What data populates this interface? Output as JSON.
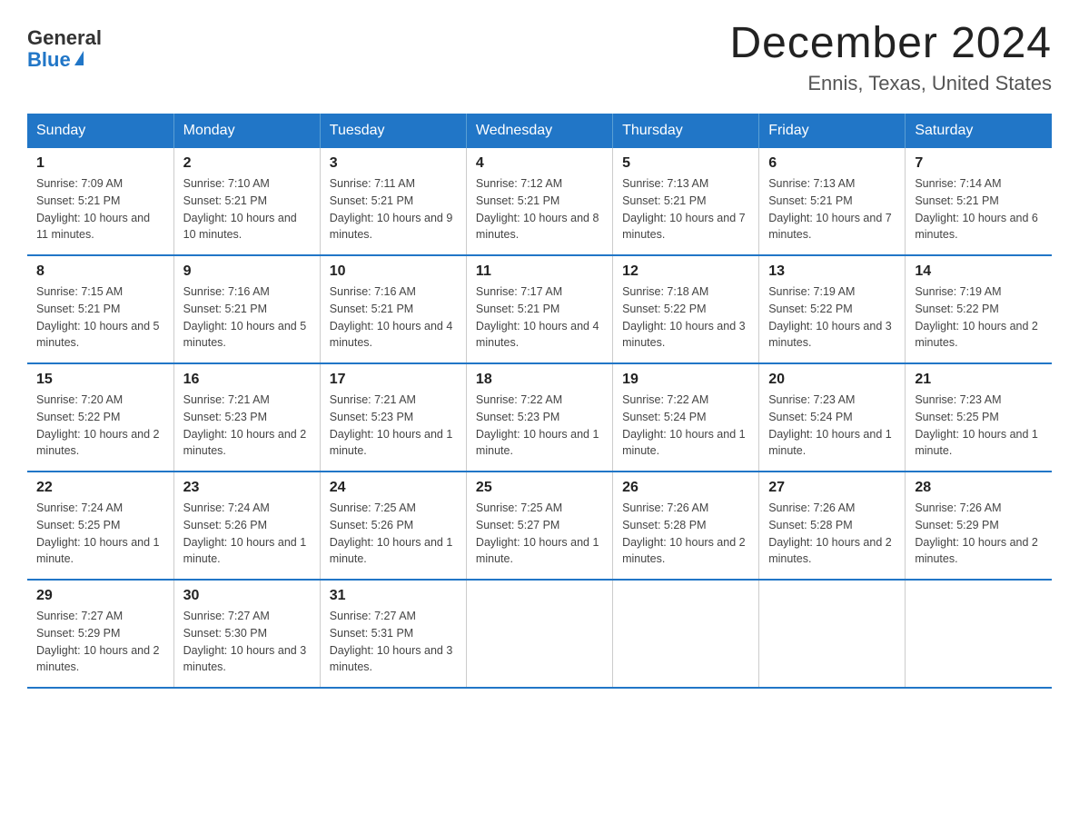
{
  "header": {
    "logo_general": "General",
    "logo_blue": "Blue",
    "title": "December 2024",
    "subtitle": "Ennis, Texas, United States"
  },
  "days_of_week": [
    "Sunday",
    "Monday",
    "Tuesday",
    "Wednesday",
    "Thursday",
    "Friday",
    "Saturday"
  ],
  "weeks": [
    [
      {
        "day": "1",
        "sunrise": "7:09 AM",
        "sunset": "5:21 PM",
        "daylight": "10 hours and 11 minutes."
      },
      {
        "day": "2",
        "sunrise": "7:10 AM",
        "sunset": "5:21 PM",
        "daylight": "10 hours and 10 minutes."
      },
      {
        "day": "3",
        "sunrise": "7:11 AM",
        "sunset": "5:21 PM",
        "daylight": "10 hours and 9 minutes."
      },
      {
        "day": "4",
        "sunrise": "7:12 AM",
        "sunset": "5:21 PM",
        "daylight": "10 hours and 8 minutes."
      },
      {
        "day": "5",
        "sunrise": "7:13 AM",
        "sunset": "5:21 PM",
        "daylight": "10 hours and 7 minutes."
      },
      {
        "day": "6",
        "sunrise": "7:13 AM",
        "sunset": "5:21 PM",
        "daylight": "10 hours and 7 minutes."
      },
      {
        "day": "7",
        "sunrise": "7:14 AM",
        "sunset": "5:21 PM",
        "daylight": "10 hours and 6 minutes."
      }
    ],
    [
      {
        "day": "8",
        "sunrise": "7:15 AM",
        "sunset": "5:21 PM",
        "daylight": "10 hours and 5 minutes."
      },
      {
        "day": "9",
        "sunrise": "7:16 AM",
        "sunset": "5:21 PM",
        "daylight": "10 hours and 5 minutes."
      },
      {
        "day": "10",
        "sunrise": "7:16 AM",
        "sunset": "5:21 PM",
        "daylight": "10 hours and 4 minutes."
      },
      {
        "day": "11",
        "sunrise": "7:17 AM",
        "sunset": "5:21 PM",
        "daylight": "10 hours and 4 minutes."
      },
      {
        "day": "12",
        "sunrise": "7:18 AM",
        "sunset": "5:22 PM",
        "daylight": "10 hours and 3 minutes."
      },
      {
        "day": "13",
        "sunrise": "7:19 AM",
        "sunset": "5:22 PM",
        "daylight": "10 hours and 3 minutes."
      },
      {
        "day": "14",
        "sunrise": "7:19 AM",
        "sunset": "5:22 PM",
        "daylight": "10 hours and 2 minutes."
      }
    ],
    [
      {
        "day": "15",
        "sunrise": "7:20 AM",
        "sunset": "5:22 PM",
        "daylight": "10 hours and 2 minutes."
      },
      {
        "day": "16",
        "sunrise": "7:21 AM",
        "sunset": "5:23 PM",
        "daylight": "10 hours and 2 minutes."
      },
      {
        "day": "17",
        "sunrise": "7:21 AM",
        "sunset": "5:23 PM",
        "daylight": "10 hours and 1 minute."
      },
      {
        "day": "18",
        "sunrise": "7:22 AM",
        "sunset": "5:23 PM",
        "daylight": "10 hours and 1 minute."
      },
      {
        "day": "19",
        "sunrise": "7:22 AM",
        "sunset": "5:24 PM",
        "daylight": "10 hours and 1 minute."
      },
      {
        "day": "20",
        "sunrise": "7:23 AM",
        "sunset": "5:24 PM",
        "daylight": "10 hours and 1 minute."
      },
      {
        "day": "21",
        "sunrise": "7:23 AM",
        "sunset": "5:25 PM",
        "daylight": "10 hours and 1 minute."
      }
    ],
    [
      {
        "day": "22",
        "sunrise": "7:24 AM",
        "sunset": "5:25 PM",
        "daylight": "10 hours and 1 minute."
      },
      {
        "day": "23",
        "sunrise": "7:24 AM",
        "sunset": "5:26 PM",
        "daylight": "10 hours and 1 minute."
      },
      {
        "day": "24",
        "sunrise": "7:25 AM",
        "sunset": "5:26 PM",
        "daylight": "10 hours and 1 minute."
      },
      {
        "day": "25",
        "sunrise": "7:25 AM",
        "sunset": "5:27 PM",
        "daylight": "10 hours and 1 minute."
      },
      {
        "day": "26",
        "sunrise": "7:26 AM",
        "sunset": "5:28 PM",
        "daylight": "10 hours and 2 minutes."
      },
      {
        "day": "27",
        "sunrise": "7:26 AM",
        "sunset": "5:28 PM",
        "daylight": "10 hours and 2 minutes."
      },
      {
        "day": "28",
        "sunrise": "7:26 AM",
        "sunset": "5:29 PM",
        "daylight": "10 hours and 2 minutes."
      }
    ],
    [
      {
        "day": "29",
        "sunrise": "7:27 AM",
        "sunset": "5:29 PM",
        "daylight": "10 hours and 2 minutes."
      },
      {
        "day": "30",
        "sunrise": "7:27 AM",
        "sunset": "5:30 PM",
        "daylight": "10 hours and 3 minutes."
      },
      {
        "day": "31",
        "sunrise": "7:27 AM",
        "sunset": "5:31 PM",
        "daylight": "10 hours and 3 minutes."
      },
      null,
      null,
      null,
      null
    ]
  ]
}
